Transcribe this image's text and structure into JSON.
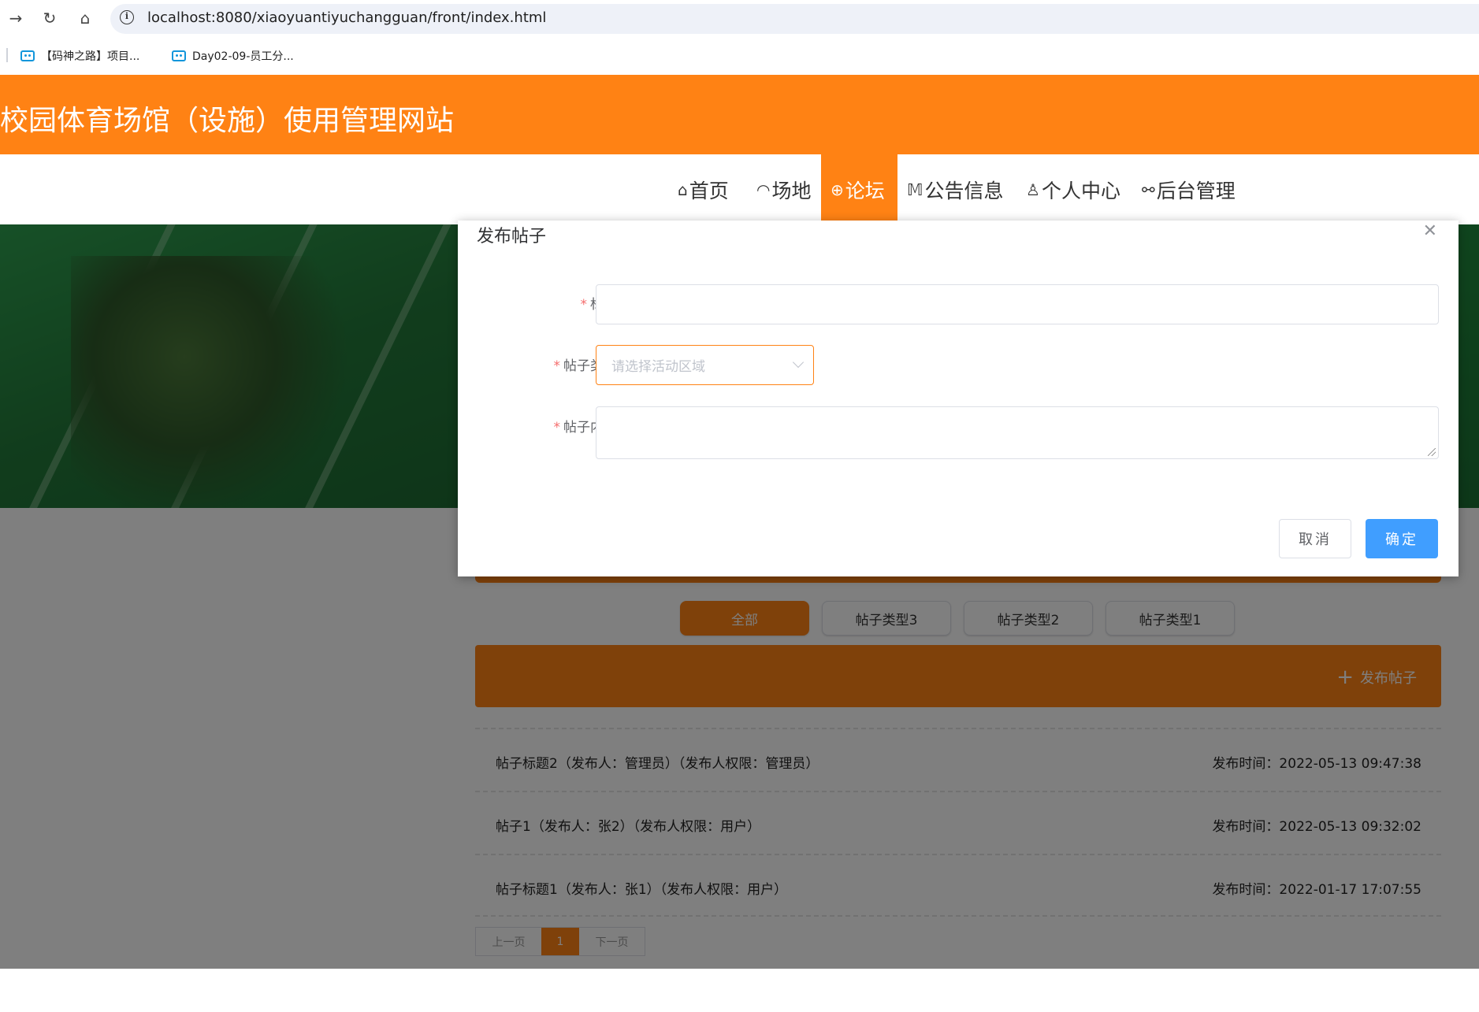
{
  "browser": {
    "url": "localhost:8080/xiaoyuantiyuchangguan/front/index.html",
    "bookmarks": [
      {
        "label": "【码神之路】项目..."
      },
      {
        "label": "Day02-09-员工分..."
      }
    ]
  },
  "site": {
    "title": "校园体育场馆（设施）使用管理网站",
    "accent_color": "#ff8214",
    "nav": [
      {
        "label": "首页",
        "icon": "home-icon"
      },
      {
        "label": "场地",
        "icon": "gauge-icon"
      },
      {
        "label": "论坛",
        "icon": "globe-icon",
        "active": true
      },
      {
        "label": "公告信息",
        "icon": "book-icon"
      },
      {
        "label": "个人中心",
        "icon": "user-icon"
      },
      {
        "label": "后台管理",
        "icon": "link-icon"
      }
    ]
  },
  "forum": {
    "filters": [
      {
        "label": "全部",
        "active": true
      },
      {
        "label": "帖子类型3"
      },
      {
        "label": "帖子类型2"
      },
      {
        "label": "帖子类型1"
      }
    ],
    "publish_label": "发布帖子",
    "posts": [
      {
        "title": "帖子标题2（发布人：管理员）（发布人权限：管理员）",
        "time": "发布时间：2022-05-13 09:47:38"
      },
      {
        "title": "帖子1（发布人：张2）（发布人权限：用户）",
        "time": "发布时间：2022-05-13 09:32:02"
      },
      {
        "title": "帖子标题1（发布人：张1）（发布人权限：用户）",
        "time": "发布时间：2022-01-17 17:07:55"
      }
    ],
    "pager": {
      "prev": "上一页",
      "current": "1",
      "next": "下一页"
    }
  },
  "dialog": {
    "title": "发布帖子",
    "fields": {
      "title_label": "标题",
      "type_label": "帖子类型",
      "type_placeholder": "请选择活动区域",
      "content_label": "帖子内容"
    },
    "cancel_label": "取消",
    "ok_label": "确定",
    "primary_color": "#409eff"
  }
}
